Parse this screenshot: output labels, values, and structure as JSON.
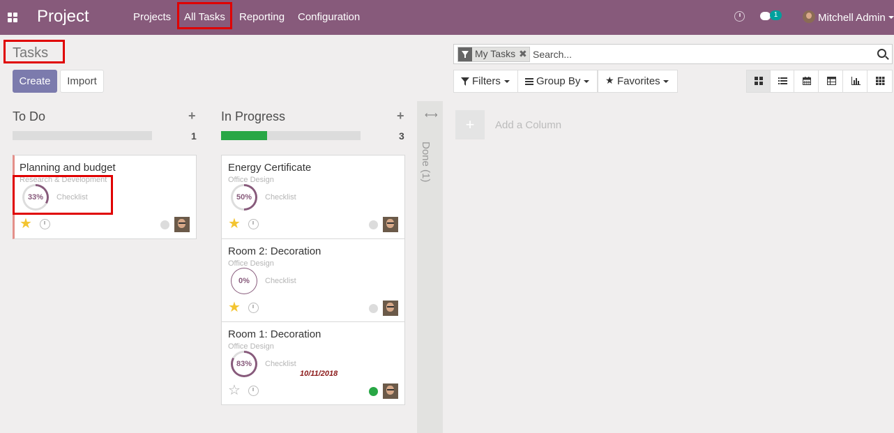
{
  "navbar": {
    "brand": "Project",
    "menu": [
      "Projects",
      "All Tasks",
      "Reporting",
      "Configuration"
    ],
    "chat_badge": "1",
    "user": "Mitchell Admin",
    "colors": {
      "bar": "#875a7b",
      "badge": "#00a09d"
    }
  },
  "control": {
    "breadcrumb": "Tasks",
    "create_label": "Create",
    "import_label": "Import",
    "search": {
      "facet": "My Tasks",
      "placeholder": "Search..."
    },
    "filters_label": "Filters",
    "group_by_label": "Group By",
    "favorites_label": "Favorites",
    "views": [
      "kanban-icon",
      "list-icon",
      "calendar-icon",
      "pivot-icon",
      "graph-icon",
      "grid-icon"
    ]
  },
  "kanban": {
    "columns": [
      {
        "title": "To Do",
        "count": "1",
        "progress": 0,
        "cards": [
          {
            "title": "Planning and budget",
            "project": "Research & Development",
            "percent": "33%",
            "checklist": "Checklist",
            "starred": true,
            "state": "grey",
            "deadline": ""
          }
        ]
      },
      {
        "title": "In Progress",
        "count": "3",
        "progress": 0.33,
        "cards": [
          {
            "title": "Energy Certificate",
            "project": "Office Design",
            "percent": "50%",
            "checklist": "Checklist",
            "starred": true,
            "state": "grey",
            "deadline": ""
          },
          {
            "title": "Room 2: Decoration",
            "project": "Office Design",
            "percent": "0%",
            "checklist": "Checklist",
            "starred": true,
            "state": "grey",
            "deadline": ""
          },
          {
            "title": "Room 1: Decoration",
            "project": "Office Design",
            "percent": "83%",
            "checklist": "Checklist",
            "starred": false,
            "state": "green",
            "deadline": "10/11/2018"
          }
        ]
      }
    ],
    "folded_column": "Done (1)",
    "add_column": "Add a Column"
  }
}
